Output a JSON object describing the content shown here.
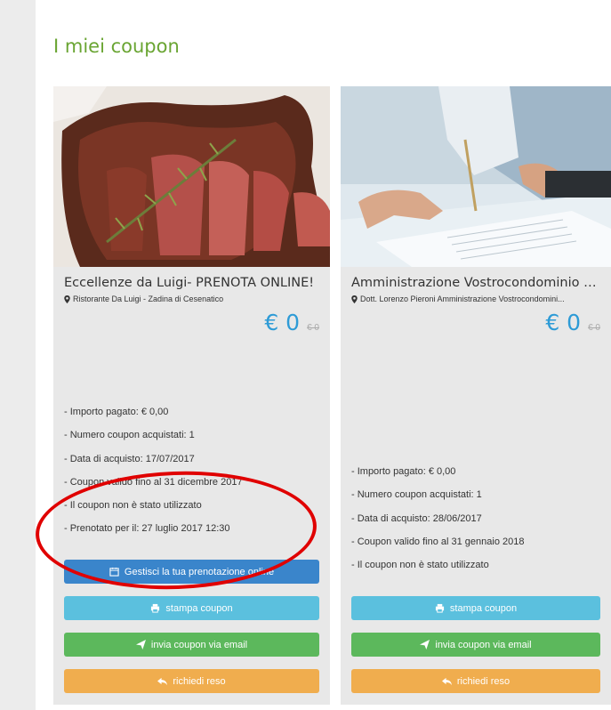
{
  "page": {
    "title": "I miei coupon"
  },
  "coupons": [
    {
      "title": "Eccellenze da Luigi- PRENOTA ONLINE!",
      "merchant": "Ristorante Da Luigi - Zadina di Cesenatico",
      "price": "€ 0",
      "old_price": "€ 0",
      "details": [
        "- Importo pagato: € 0,00",
        "- Numero coupon acquistati: 1",
        "- Data di acquisto: 17/07/2017",
        "- Coupon valido fino al 31 dicembre 2017",
        "- Il coupon non è stato utilizzato",
        "- Prenotato per il: 27 luglio 2017 12:30"
      ],
      "buttons": {
        "manage": "Gestisci la tua prenotazione online",
        "print": "stampa coupon",
        "email": "invia coupon via email",
        "refund": "richiedi reso"
      }
    },
    {
      "title": "Amministrazione Vostrocondominio e ...",
      "merchant": "Dott. Lorenzo Pieroni Amministrazione Vostrocondomini...",
      "price": "€ 0",
      "old_price": "€ 0",
      "details": [
        "- Importo pagato: € 0,00",
        "- Numero coupon acquistati: 1",
        "- Data di acquisto: 28/06/2017",
        "- Coupon valido fino al 31 gennaio 2018",
        "- Il coupon non è stato utilizzato"
      ],
      "buttons": {
        "print": "stampa coupon",
        "email": "invia coupon via email",
        "refund": "richiedi reso"
      }
    }
  ],
  "colors": {
    "title_green": "#6aa533",
    "price_blue": "#2e9bd6",
    "btn_blue": "#3a85cb",
    "btn_cyan": "#5bc0de",
    "btn_green": "#5cb85c",
    "btn_orange": "#f0ad4e",
    "annotation_red": "#e00000"
  },
  "icons": [
    "map-marker-icon",
    "calendar-icon",
    "print-icon",
    "paper-plane-icon",
    "reply-icon"
  ]
}
